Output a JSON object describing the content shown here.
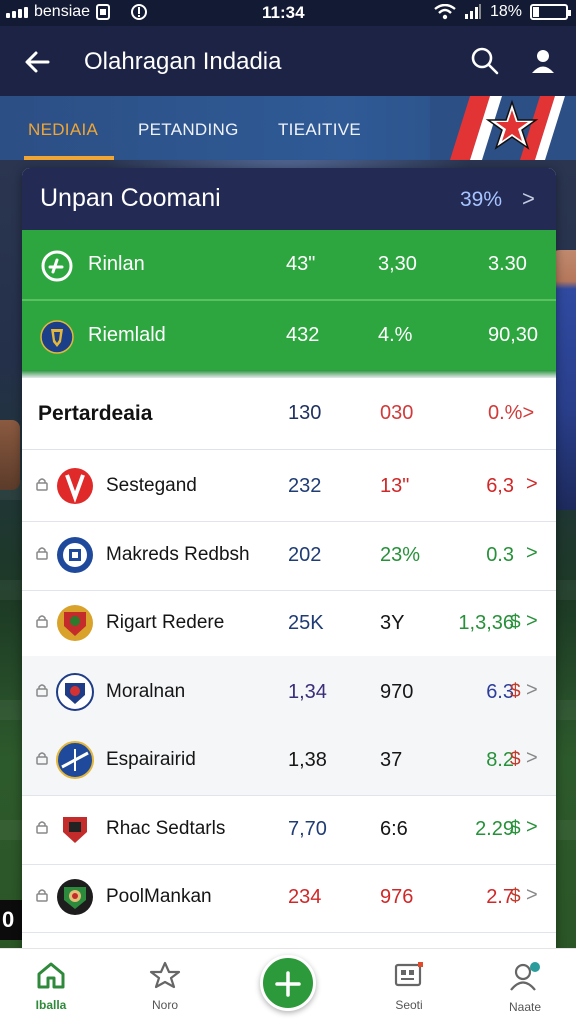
{
  "status_bar": {
    "carrier": "bensiae",
    "time": "11:34",
    "battery": "18%",
    "battery_level": 0.18
  },
  "header": {
    "title": "Olahragan Indadia",
    "icons": [
      "back-arrow-icon",
      "search-icon",
      "profile-icon"
    ]
  },
  "tabs": [
    {
      "label": "NEDIAIA",
      "active": true
    },
    {
      "label": "PETANDING",
      "active": false
    },
    {
      "label": "TIEAITIVE",
      "active": false
    }
  ],
  "card": {
    "title": "Unpan Coomani",
    "percent": "39%",
    "chevron": ">",
    "highlight_rows": [
      {
        "name": "Rinlan",
        "c1": "43\"",
        "c2": "3,30",
        "c3": "3.30",
        "icon": "soccer-ball-icon"
      },
      {
        "name": "Riemlald",
        "c1": "432",
        "c2": "4.%",
        "c3": "90,30",
        "icon": "club-crest-icon"
      }
    ],
    "section": {
      "name": "Pertardeaia",
      "c1": "130",
      "c2": "030",
      "c3": "0.%",
      "chev": ">"
    },
    "rows": [
      {
        "name": "Sestegand",
        "c1": "232",
        "c2": "13\"",
        "c3": "6,3",
        "cur": "",
        "chev": ">",
        "c1_color": "#1f3c75",
        "c2_color": "#d02828",
        "c3_color": "#d02828",
        "chev_color": "#d02828"
      },
      {
        "name": "Makreds Redbsh",
        "c1": "202",
        "c2": "23%",
        "c3": "0.3",
        "cur": "",
        "chev": ">",
        "c1_color": "#1f3c75",
        "c2_color": "#27913a",
        "c3_color": "#27913a",
        "chev_color": "#27913a"
      },
      {
        "name": "Rigart Redere",
        "c1": "25K",
        "c2": "3Y",
        "c3": "1,3,36",
        "cur": "$",
        "chev": ">",
        "c1_color": "#1f3c75",
        "c2_color": "#161616",
        "c3_color": "#27913a",
        "chev_color": "#27913a"
      },
      {
        "name": "Moralnan",
        "c1": "1,34",
        "c2": "970",
        "c3": "6.3",
        "cur": "$",
        "chev": ">",
        "c1_color": "#3a2d7a",
        "c2_color": "#161616",
        "c3_color": "#2d3e9a",
        "chev_color": "#888888"
      },
      {
        "name": "Espairairid",
        "c1": "1,38",
        "c2": "37",
        "c3": "8.2",
        "cur": "$",
        "chev": ">",
        "c1_color": "#161616",
        "c2_color": "#161616",
        "c3_color": "#27913a",
        "chev_color": "#888888"
      },
      {
        "name": "Rhac Sedtarls",
        "c1": "7,70",
        "c2": "6:6",
        "c3": "2.29",
        "cur": "$",
        "chev": ">",
        "c1_color": "#1f3c75",
        "c2_color": "#161616",
        "c3_color": "#27913a",
        "chev_color": "#27913a"
      },
      {
        "name": "PoolMankan",
        "c1": "234",
        "c2": "976",
        "c3": "2.7",
        "cur": "$",
        "chev": ">",
        "c1_color": "#d02828",
        "c2_color": "#d02828",
        "c3_color": "#d02828",
        "chev_color": "#888888"
      }
    ]
  },
  "bottom_nav": [
    {
      "label": "Iballa",
      "icon": "home-icon",
      "active": true
    },
    {
      "label": "Noro",
      "icon": "star-icon",
      "active": false
    },
    {
      "label": "",
      "icon": "plus-icon",
      "active": false
    },
    {
      "label": "Seoti",
      "icon": "scoreboard-icon",
      "active": false
    },
    {
      "label": "Naate",
      "icon": "user-icon",
      "active": false
    }
  ]
}
